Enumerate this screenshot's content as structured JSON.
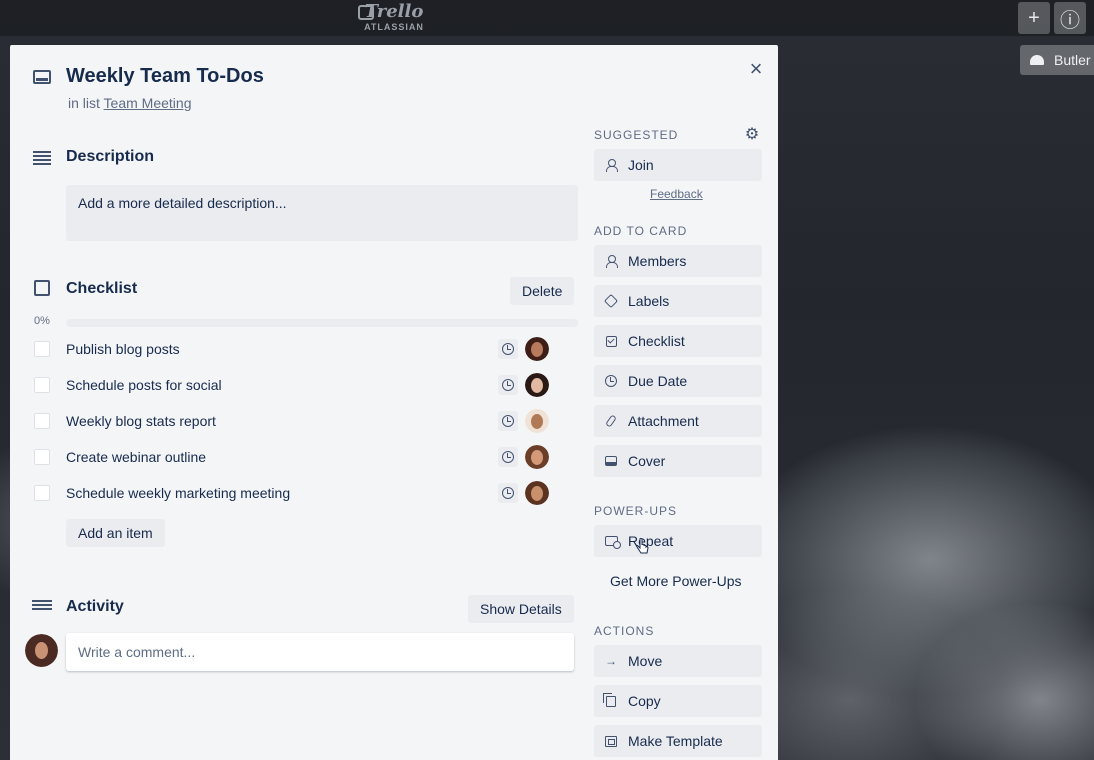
{
  "topbar": {
    "logo_word": "Trello",
    "logo_sub": "ATLASSIAN",
    "add_glyph": "+",
    "info_glyph": "ⓘ",
    "butler_label": "Butler"
  },
  "card": {
    "title": "Weekly Team To-Dos",
    "in_list_prefix": "in list",
    "list_name": "Team Meeting",
    "close_glyph": "×"
  },
  "description": {
    "title": "Description",
    "placeholder": "Add a more detailed description..."
  },
  "checklist": {
    "title": "Checklist",
    "delete_label": "Delete",
    "progress_label": "0%",
    "progress_value": 0,
    "add_item_label": "Add an item",
    "items": [
      {
        "text": "Publish blog posts"
      },
      {
        "text": "Schedule posts for social"
      },
      {
        "text": "Weekly blog stats report"
      },
      {
        "text": "Create webinar outline"
      },
      {
        "text": "Schedule weekly marketing meeting"
      }
    ]
  },
  "activity": {
    "title": "Activity",
    "show_details_label": "Show Details",
    "comment_placeholder": "Write a comment..."
  },
  "sidebar": {
    "suggested_label": "SUGGESTED",
    "join_label": "Join",
    "feedback_label": "Feedback",
    "add_to_card_label": "ADD TO CARD",
    "add_items": [
      {
        "label": "Members",
        "icon": "person-icon"
      },
      {
        "label": "Labels",
        "icon": "tag-icon"
      },
      {
        "label": "Checklist",
        "icon": "checklist-icon"
      },
      {
        "label": "Due Date",
        "icon": "clock-icon"
      },
      {
        "label": "Attachment",
        "icon": "paperclip-icon"
      },
      {
        "label": "Cover",
        "icon": "cover-icon"
      }
    ],
    "power_ups_label": "POWER-UPS",
    "repeat_label": "Repeat",
    "get_more_label": "Get More Power-Ups",
    "actions_label": "ACTIONS",
    "move_label": "Move",
    "copy_label": "Copy",
    "template_label": "Make Template"
  },
  "colors": {
    "modal_bg": "#f4f5f7",
    "button_bg": "#ebecf0",
    "text": "#172b4d",
    "muted": "#5e6c84"
  }
}
